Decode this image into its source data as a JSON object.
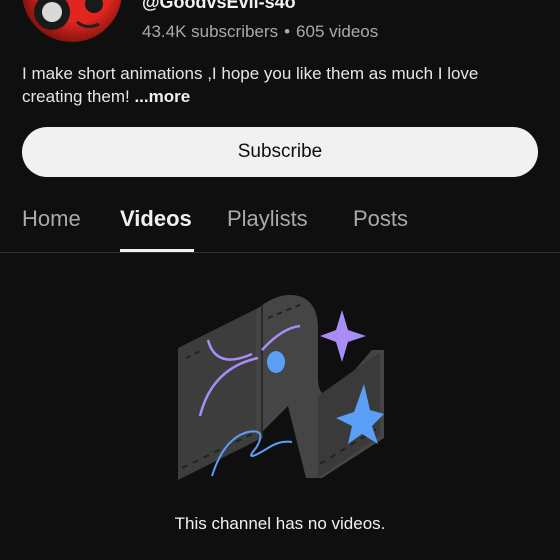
{
  "channel": {
    "handle": "@GoodvsEvil-s4o",
    "subscribers": "43.4K subscribers",
    "separator": "•",
    "videos_count": "605 videos",
    "description": "I make short animations ,I hope you like them as much I love creating them! ",
    "more_label": "...more"
  },
  "subscribe_label": "Subscribe",
  "tabs": [
    {
      "label": "Home",
      "active": false
    },
    {
      "label": "Videos",
      "active": true
    },
    {
      "label": "Playlists",
      "active": false
    },
    {
      "label": "Posts",
      "active": false
    }
  ],
  "empty_state": {
    "message": "This channel has no videos.",
    "illustration": "empty-video-illustration"
  },
  "colors": {
    "background": "#0f0f0f",
    "primary_text": "#f1f1f1",
    "secondary_text": "#aaaaaa",
    "accent_purple": "#a98cf5",
    "accent_blue": "#5b9ef5"
  }
}
